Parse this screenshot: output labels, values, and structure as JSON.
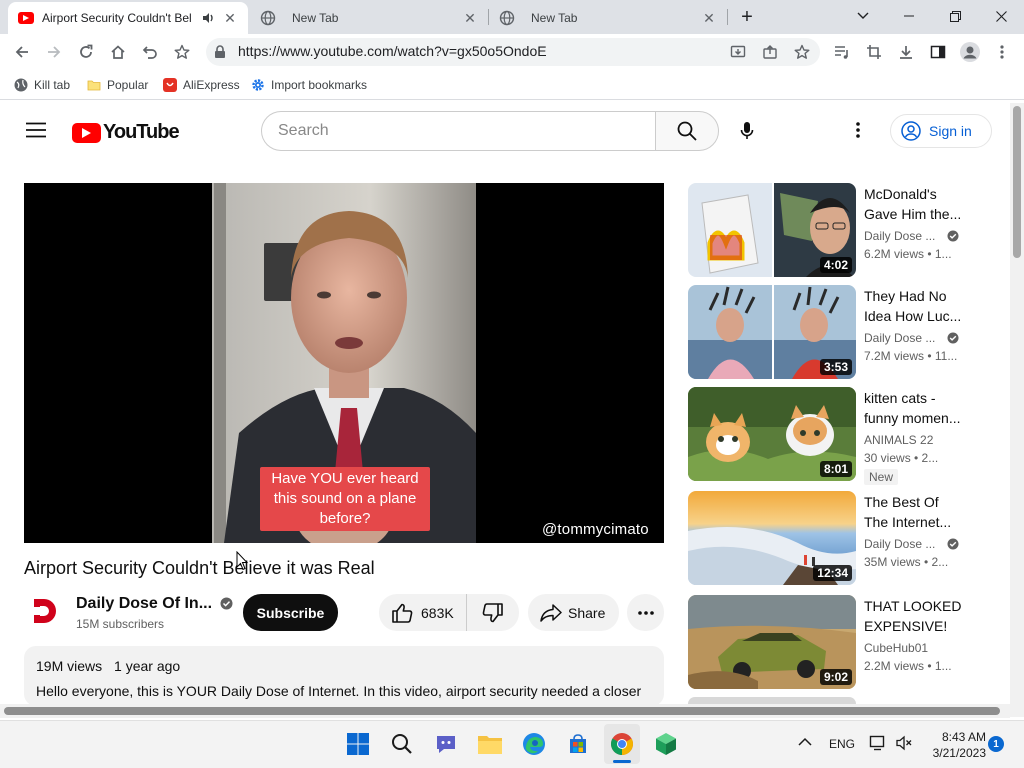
{
  "browser": {
    "tabs": [
      {
        "title": "Airport Security Couldn't Bel",
        "active": true
      },
      {
        "title": "New Tab",
        "active": false
      },
      {
        "title": "New Tab",
        "active": false
      }
    ],
    "url": "https://www.youtube.com/watch?v=gx50o5OndoE",
    "bookmarks": [
      "Kill tab",
      "Popular",
      "AliExpress",
      "Import bookmarks"
    ]
  },
  "youtube": {
    "logo_text": "YouTube",
    "search_placeholder": "Search",
    "signin_label": "Sign in"
  },
  "video": {
    "caption": "Have YOU ever heard this sound on a plane before?",
    "watermark": "@tommycimato",
    "title": "Airport Security Couldn't Believe it was Real",
    "channel": "Daily Dose Of In...",
    "subscribers": "15M subscribers",
    "subscribe_label": "Subscribe",
    "likes": "683K",
    "share_label": "Share",
    "views": "19M views",
    "age": "1 year ago",
    "description": "Hello everyone, this is YOUR Daily Dose of Internet. In this video, airport security needed a closer look"
  },
  "recommendations": [
    {
      "title1": "McDonald's",
      "title2": "Gave Him the...",
      "channel": "Daily Dose ...",
      "verified": true,
      "meta": "6.2M views  •  1...",
      "duration": "4:02"
    },
    {
      "title1": "They Had No",
      "title2": "Idea How Luc...",
      "channel": "Daily Dose ...",
      "verified": true,
      "meta": "7.2M views  •  11...",
      "duration": "3:53"
    },
    {
      "title1": "kitten cats -",
      "title2": "funny momen...",
      "channel": "ANIMALS 22",
      "verified": false,
      "meta": "30 views  •  2...",
      "duration": "8:01",
      "badge": "New"
    },
    {
      "title1": "The Best Of",
      "title2": "The Internet...",
      "channel": "Daily Dose ...",
      "verified": true,
      "meta": "35M views  •  2...",
      "duration": "12:34"
    },
    {
      "title1": "THAT LOOKED",
      "title2": "EXPENSIVE!",
      "channel": "CubeHub01",
      "verified": false,
      "meta": "2.2M views  •  1...",
      "duration": "9:02"
    }
  ],
  "taskbar": {
    "language": "ENG",
    "time": "8:43 AM",
    "date": "3/21/2023",
    "notification_count": "1"
  }
}
